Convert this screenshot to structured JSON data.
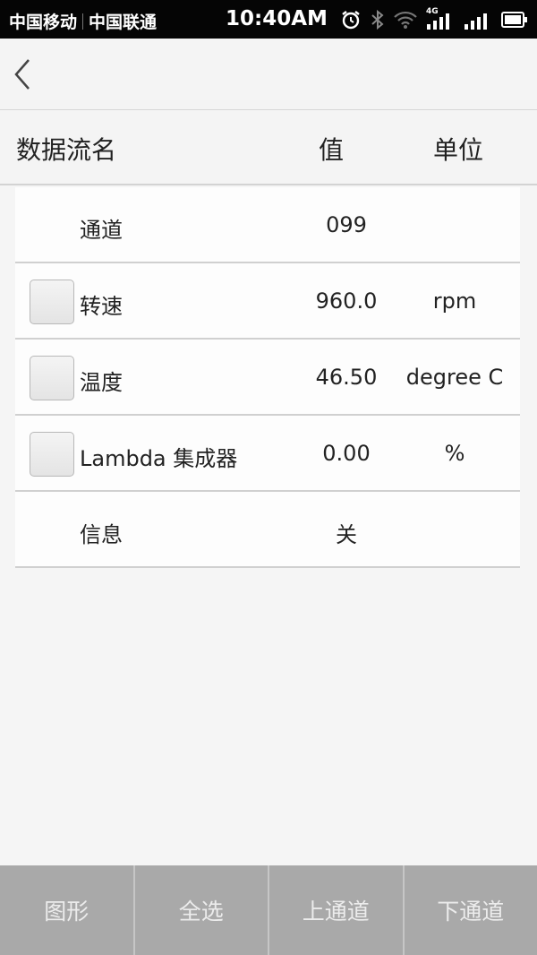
{
  "status_bar": {
    "carrier1": "中国移动",
    "carrier2": "中国联通",
    "time": "10:40AM",
    "network_type": "4G",
    "icons": [
      "alarm-icon",
      "bluetooth-icon",
      "wifi-icon",
      "signal-icon",
      "signal-icon",
      "battery-icon"
    ]
  },
  "app_bar": {
    "back_icon": "back-chevron-icon"
  },
  "table": {
    "headers": {
      "name": "数据流名",
      "value": "值",
      "unit": "单位"
    },
    "rows": [
      {
        "name": "通道",
        "value": "099",
        "unit": "",
        "checkbox": false
      },
      {
        "name": "转速",
        "value": "960.0",
        "unit": "rpm",
        "checkbox": true,
        "checked": false
      },
      {
        "name": "温度",
        "value": "46.50",
        "unit": "degree C",
        "checkbox": true,
        "checked": false
      },
      {
        "name": "Lambda 集成器",
        "value": "0.00",
        "unit": "%",
        "checkbox": true,
        "checked": false
      },
      {
        "name": "信息",
        "value": "关",
        "unit": "",
        "checkbox": false
      }
    ]
  },
  "toolbar": {
    "graph": "图形",
    "select_all": "全选",
    "prev_channel": "上通道",
    "next_channel": "下通道"
  },
  "colors": {
    "status_bar_bg": "#050505",
    "page_bg": "#f5f5f5",
    "row_bg": "#fdfdfd",
    "toolbar_bg": "#a9a9a9",
    "toolbar_text": "#ececec"
  }
}
